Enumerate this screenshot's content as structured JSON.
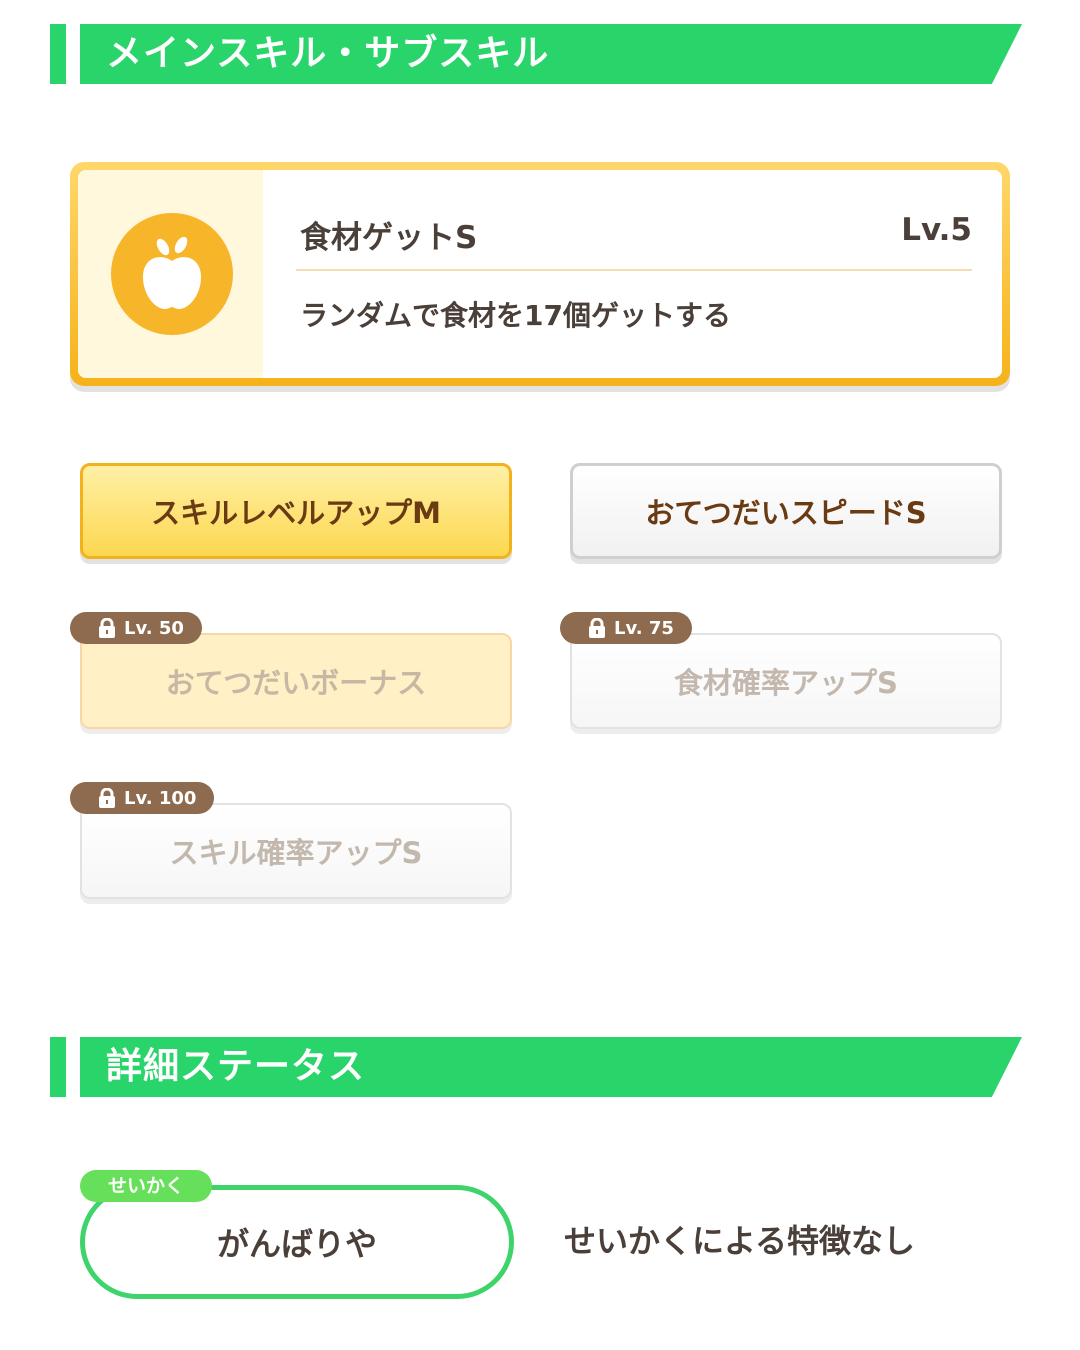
{
  "colors": {
    "section_green": "#29d46a",
    "accent_gold": "#f7b62a",
    "lock_tag_brown": "#8e6b4f",
    "nature_green": "#3ed46b"
  },
  "skills_section": {
    "title": "メインスキル・サブスキル"
  },
  "main_skill": {
    "icon": "apple-icon",
    "name": "食材ゲットS",
    "level": "Lv.5",
    "description": "ランダムで食材を17個ゲットする"
  },
  "sub_skills": [
    {
      "name": "スキルレベルアップM",
      "style": "gold",
      "locked": false
    },
    {
      "name": "おてつだいスピードS",
      "style": "white",
      "locked": false
    },
    {
      "name": "おてつだいボーナス",
      "style": "gold",
      "locked": true,
      "unlock_level": "Lv. 50",
      "lock_icon": "lock-icon"
    },
    {
      "name": "食材確率アップS",
      "style": "white",
      "locked": true,
      "unlock_level": "Lv. 75",
      "lock_icon": "lock-icon"
    },
    {
      "name": "スキル確率アップS",
      "style": "white",
      "locked": true,
      "unlock_level": "Lv. 100",
      "lock_icon": "lock-icon"
    }
  ],
  "status_section": {
    "title": "詳細ステータス"
  },
  "nature": {
    "tag": "せいかく",
    "value": "がんばりや",
    "effect": "せいかくによる特徴なし"
  }
}
